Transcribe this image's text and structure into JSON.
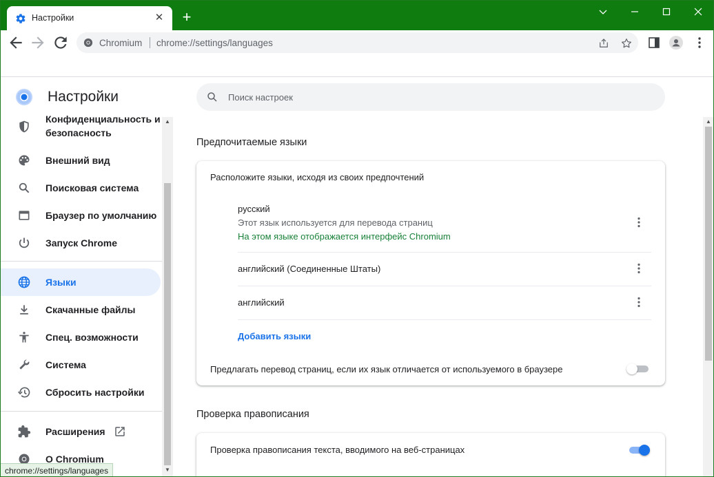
{
  "browser": {
    "tab_title": "Настройки",
    "new_tab": "+",
    "origin": "Chromium",
    "url": "chrome://settings/languages",
    "frame_color": "#0f7c10",
    "status_url": "chrome://settings/languages"
  },
  "settings": {
    "title": "Настройки",
    "search_placeholder": "Поиск настроек"
  },
  "sidebar": {
    "items": [
      {
        "label": "Конфиденциальность и",
        "label2": "безопасность",
        "icon": "shield-icon"
      },
      {
        "label": "Внешний вид",
        "icon": "palette-icon"
      },
      {
        "label": "Поисковая система",
        "icon": "search-icon"
      },
      {
        "label": "Браузер по умолчанию",
        "icon": "browser-window-icon"
      },
      {
        "label": "Запуск Chrome",
        "icon": "power-icon"
      },
      {
        "label": "Языки",
        "icon": "globe-icon",
        "active": true
      },
      {
        "label": "Скачанные файлы",
        "icon": "download-icon"
      },
      {
        "label": "Спец. возможности",
        "icon": "accessibility-icon"
      },
      {
        "label": "Система",
        "icon": "wrench-icon"
      },
      {
        "label": "Сбросить настройки",
        "icon": "restore-icon"
      },
      {
        "label": "Расширения",
        "icon": "puzzle-icon"
      },
      {
        "label": "О Chromium",
        "icon": "chromium-icon"
      }
    ]
  },
  "languages": {
    "section_title": "Предпочитаемые языки",
    "card_header": "Расположите языки, исходя из своих предпочтений",
    "items": [
      {
        "name": "русский",
        "note": "Этот язык используется для перевода страниц",
        "note2": "На этом языке отображается интерфейс Chromium"
      },
      {
        "name": "английский (Соединенные Штаты)"
      },
      {
        "name": "английский"
      }
    ],
    "add_label": "Добавить языки",
    "offer_translate": "Предлагать перевод страниц, если их язык отличается от используемого в браузере",
    "offer_translate_on": false
  },
  "spellcheck": {
    "section_title": "Проверка правописания",
    "label": "Проверка правописания текста, вводимого на веб-страницах",
    "on": true
  },
  "colors": {
    "accent": "#1a73e8",
    "green_text": "#188038"
  }
}
